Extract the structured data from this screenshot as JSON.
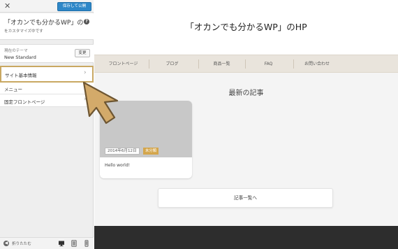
{
  "sidebar": {
    "close_icon": "close-icon",
    "publish_label": "保存して公開",
    "site_name": "「オカンでも分かるWP」の",
    "help_icon": "help-icon",
    "help_glyph": "?",
    "customizing_label": "をカスタマイズ中です",
    "theme_caption": "現在のテーマ",
    "theme_name": "New Standard",
    "change_label": "変更",
    "sections": [
      {
        "label": "サイト基本情報",
        "chevron": "›"
      },
      {
        "label": "メニュー"
      },
      {
        "label": "固定フロントページ",
        "chevron": "›"
      }
    ],
    "collapse_label": "折りたたむ",
    "collapse_glyph": "◀",
    "devices": [
      "desktop-icon",
      "tablet-icon",
      "mobile-icon"
    ]
  },
  "preview": {
    "site_title": "「オカンでも分かるWP」のHP",
    "nav": [
      "フロントページ",
      "ブログ",
      "商品一覧",
      "FAQ",
      "お問い合わせ"
    ],
    "news_heading": "最新の記事",
    "post": {
      "date": "2014年6月12日",
      "category": "未分類",
      "title": "Hello world!"
    },
    "all_posts_label": "記事一覧へ"
  },
  "colors": {
    "publish": "#2e87c8",
    "highlight": "#c9a862",
    "category": "#d4a64c",
    "nav_bg": "#e9e4dc",
    "footer": "#2d2d2d",
    "pointer": "#d3aa6a"
  }
}
